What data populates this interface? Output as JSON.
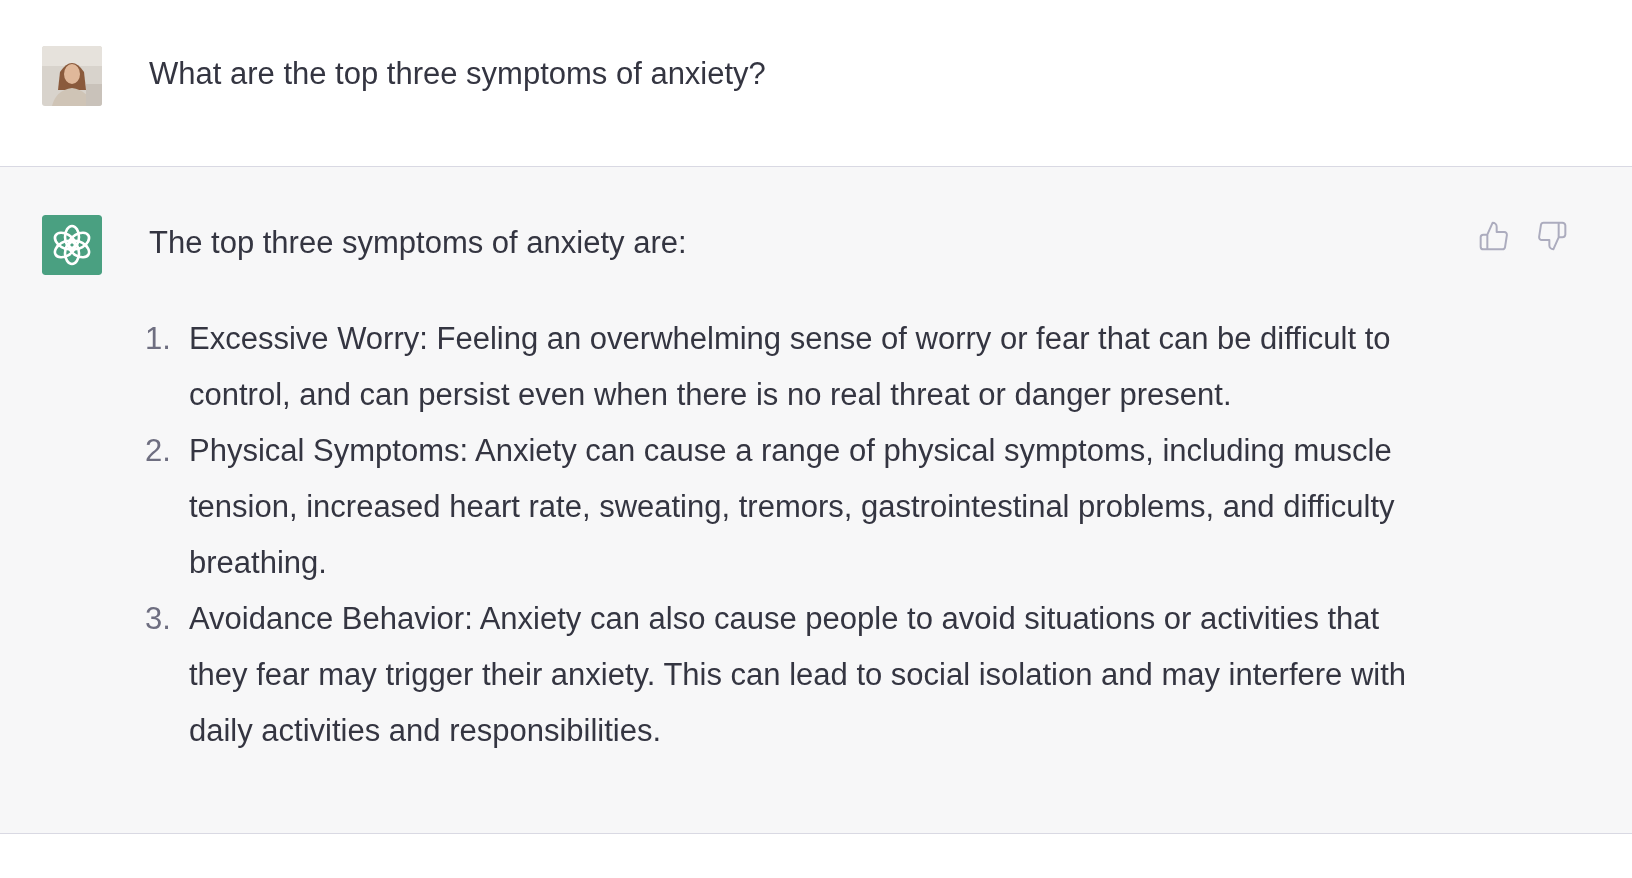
{
  "messages": [
    {
      "kind": "user",
      "text": "What are the top three symptoms of anxiety?"
    },
    {
      "kind": "assistant",
      "text": "The top three symptoms of anxiety are:",
      "list": [
        {
          "number": "1.",
          "text": "Excessive Worry: Feeling an overwhelming sense of worry or fear that can be difficult to control, and can persist even when there is no real threat or danger present."
        },
        {
          "number": "2.",
          "text": "Physical Symptoms: Anxiety can cause a range of physical symptoms, including muscle tension, increased heart rate, sweating, tremors, gastrointestinal problems, and difficulty breathing."
        },
        {
          "number": "3.",
          "text": "Avoidance Behavior: Anxiety can also cause people to avoid situations or activities that they fear may trigger their anxiety. This can lead to social isolation and may interfere with daily activities and responsibilities."
        }
      ]
    }
  ]
}
